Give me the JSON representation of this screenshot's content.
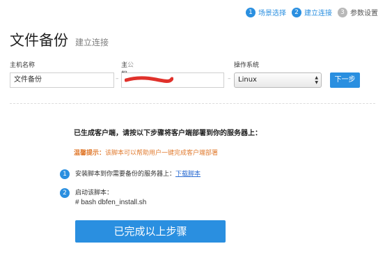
{
  "steps": [
    {
      "num": "1",
      "label": "场景选择"
    },
    {
      "num": "2",
      "label": "建立连接"
    },
    {
      "num": "3",
      "label": "参数设置"
    }
  ],
  "header": {
    "title": "文件备份",
    "subtitle": "建立连接"
  },
  "form": {
    "host_label": "主机名称",
    "ip_label": "主机IP",
    "ip_hint": "（公网IP）",
    "os_label": "操作系统",
    "host_value": "文件备份",
    "separator": "–",
    "os_value": "Linux",
    "next_button": "下一步"
  },
  "instructions": {
    "headline": "已生成客户端，请按以下步骤将客户端部署到你的服务器上：",
    "warning_prefix": "温馨提示：",
    "warning_text": "该脚本可以帮助用户一键完成客户端部署",
    "step1_num": "1",
    "step1_text": "安装脚本到你需要备份的服务器上：",
    "step1_link": "下载脚本",
    "step2_num": "2",
    "step2_text": "启动该脚本：",
    "step2_cmd": "# bash dbfen_install.sh",
    "done_button": "已完成以上步骤"
  },
  "colors": {
    "accent": "#2a8fe0",
    "warning": "#e07a2e",
    "redaction": "#e0312b"
  }
}
